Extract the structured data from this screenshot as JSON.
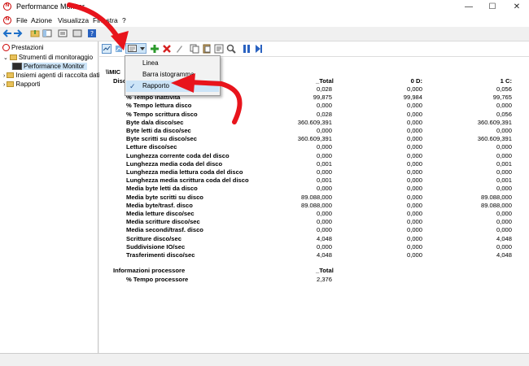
{
  "window": {
    "title": "Performance Monitor",
    "minimize": "—",
    "maximize": "☐",
    "close": "✕"
  },
  "menubar": {
    "items": [
      "File",
      "Azione",
      "Visualizza",
      "Finestra",
      "?"
    ],
    "app_icon": "N"
  },
  "tree": {
    "root": "Prestazioni",
    "child": "Strumenti di monitoraggio",
    "leaf": "Performance Monitor",
    "sibling1": "Insiemi agenti di raccolta dati",
    "sibling2": "Rapporti"
  },
  "dropdown": {
    "items": [
      {
        "label": "Linea",
        "checked": false
      },
      {
        "label": "Barra istogramma",
        "checked": false
      },
      {
        "label": "Rapporto",
        "checked": true
      }
    ]
  },
  "report": {
    "computer": "\\\\MIC",
    "object_label": "Disco",
    "columns": [
      "_Total",
      "0 D:",
      "1 C:"
    ],
    "rows": [
      {
        "name": "",
        "v": [
          "0,028",
          "0,000",
          "0,056"
        ]
      },
      {
        "name": "% Tempo inattività",
        "v": [
          "99,875",
          "99,984",
          "99,765"
        ]
      },
      {
        "name": "% Tempo lettura disco",
        "v": [
          "0,000",
          "0,000",
          "0,000"
        ]
      },
      {
        "name": "% Tempo scrittura disco",
        "v": [
          "0,028",
          "0,000",
          "0,056"
        ]
      },
      {
        "name": "Byte da/a disco/sec",
        "v": [
          "360.609,391",
          "0,000",
          "360.609,391"
        ]
      },
      {
        "name": "Byte letti da disco/sec",
        "v": [
          "0,000",
          "0,000",
          "0,000"
        ]
      },
      {
        "name": "Byte scritti su disco/sec",
        "v": [
          "360.609,391",
          "0,000",
          "360.609,391"
        ]
      },
      {
        "name": "Letture disco/sec",
        "v": [
          "0,000",
          "0,000",
          "0,000"
        ]
      },
      {
        "name": "Lunghezza corrente coda del disco",
        "v": [
          "0,000",
          "0,000",
          "0,000"
        ]
      },
      {
        "name": "Lunghezza media coda del disco",
        "v": [
          "0,001",
          "0,000",
          "0,001"
        ]
      },
      {
        "name": "Lunghezza media lettura coda del disco",
        "v": [
          "0,000",
          "0,000",
          "0,000"
        ]
      },
      {
        "name": "Lunghezza media scrittura coda del disco",
        "v": [
          "0,001",
          "0,000",
          "0,001"
        ]
      },
      {
        "name": "Media byte letti da disco",
        "v": [
          "0,000",
          "0,000",
          "0,000"
        ]
      },
      {
        "name": "Media byte scritti su disco",
        "v": [
          "89.088,000",
          "0,000",
          "89.088,000"
        ]
      },
      {
        "name": "Media byte/trasf. disco",
        "v": [
          "89.088,000",
          "0,000",
          "89.088,000"
        ]
      },
      {
        "name": "Media letture disco/sec",
        "v": [
          "0,000",
          "0,000",
          "0,000"
        ]
      },
      {
        "name": "Media scritture disco/sec",
        "v": [
          "0,000",
          "0,000",
          "0,000"
        ]
      },
      {
        "name": "Media secondi/trasf. disco",
        "v": [
          "0,000",
          "0,000",
          "0,000"
        ]
      },
      {
        "name": "Scritture disco/sec",
        "v": [
          "4,048",
          "0,000",
          "4,048"
        ]
      },
      {
        "name": "Suddivisione IO/sec",
        "v": [
          "0,000",
          "0,000",
          "0,000"
        ]
      },
      {
        "name": "Trasferimenti disco/sec",
        "v": [
          "4,048",
          "0,000",
          "4,048"
        ]
      }
    ],
    "processor": {
      "label": "Informazioni processore",
      "column": "_Total",
      "counter": "% Tempo processore",
      "value": "2,376"
    }
  },
  "colors": {
    "arrow": "#e8141c",
    "selection": "#cce4f7"
  }
}
